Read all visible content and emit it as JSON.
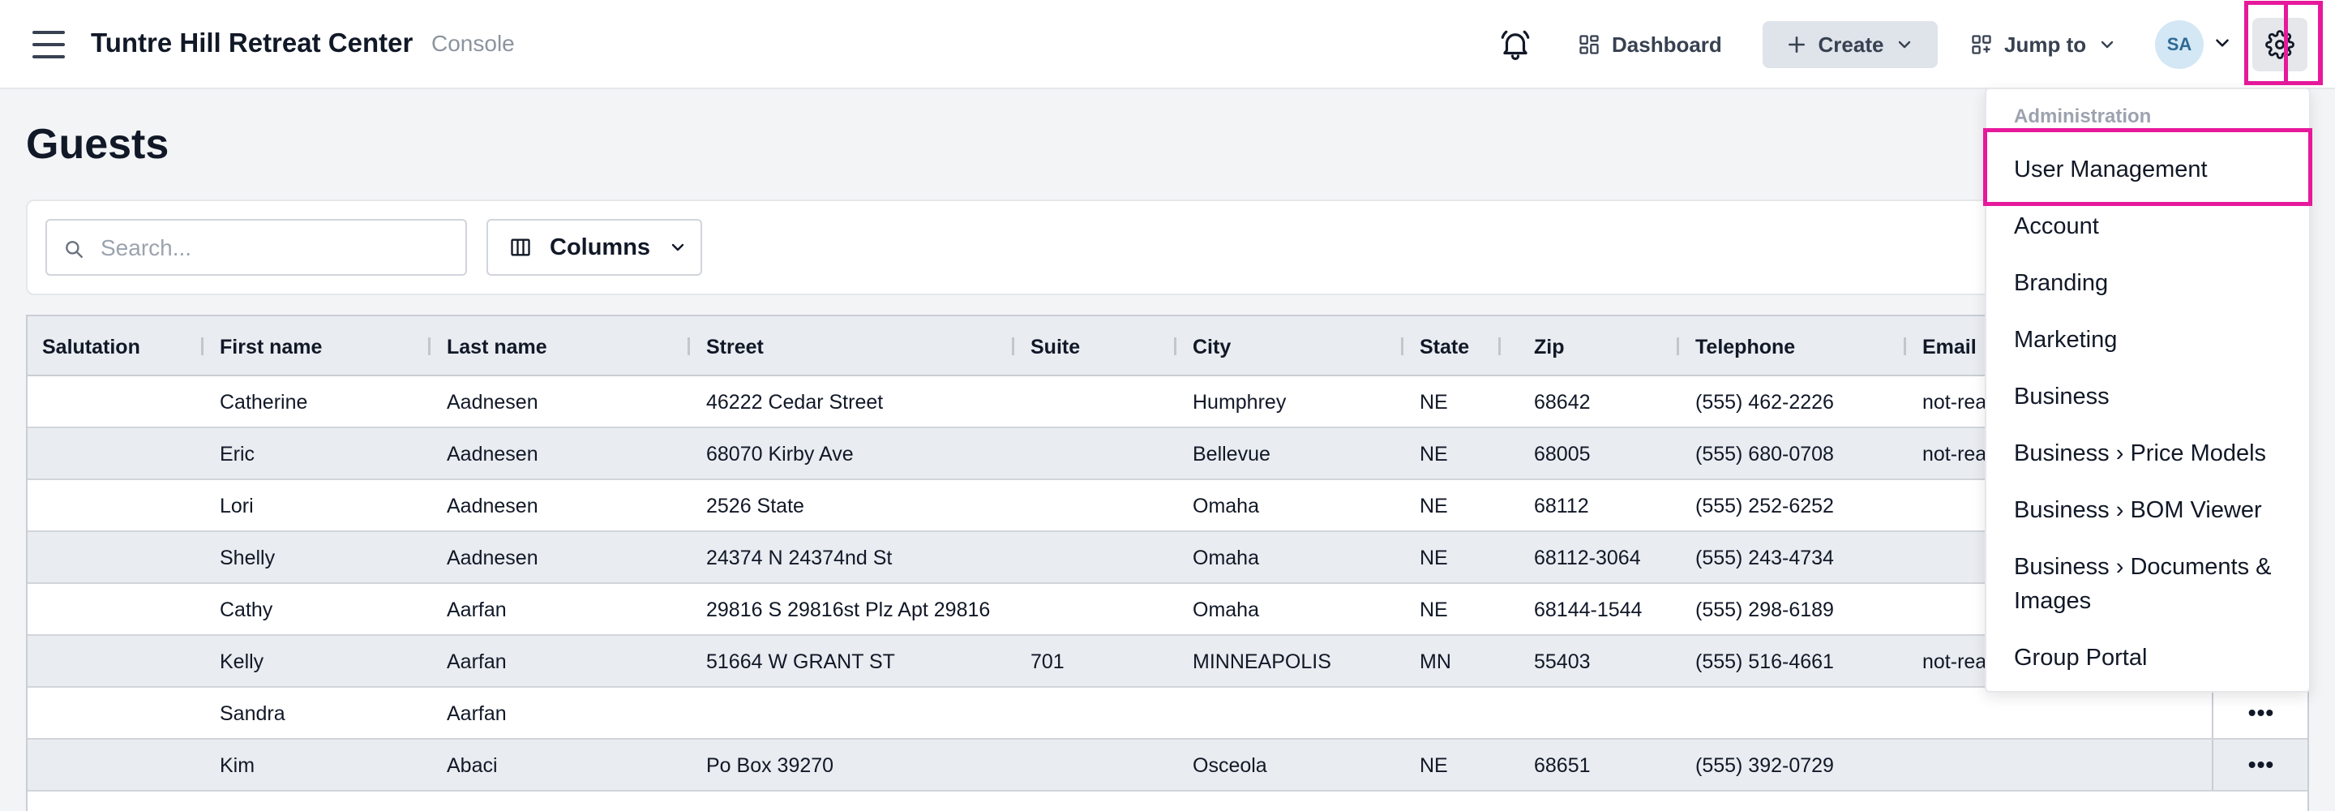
{
  "header": {
    "app_title": "Tuntre Hill Retreat Center",
    "app_subtitle": "Console",
    "dashboard_label": "Dashboard",
    "create_label": "Create",
    "jump_label": "Jump to",
    "avatar_initials": "SA"
  },
  "page": {
    "title": "Guests",
    "search_placeholder": "Search...",
    "columns_label": "Columns"
  },
  "table": {
    "headers": [
      "Salutation",
      "First name",
      "Last name",
      "Street",
      "Suite",
      "City",
      "State",
      "Zip",
      "Telephone",
      "Email"
    ],
    "rows": [
      {
        "first": "Catherine",
        "last": "Aadnesen",
        "street": "46222 Cedar Street",
        "suite": "",
        "city": "Humphrey",
        "state": "NE",
        "zip": "68642",
        "phone": "(555) 462-2226",
        "email": "not-rea"
      },
      {
        "first": "Eric",
        "last": "Aadnesen",
        "street": "68070 Kirby Ave",
        "suite": "",
        "city": "Bellevue",
        "state": "NE",
        "zip": "68005",
        "phone": "(555) 680-0708",
        "email": "not-rea"
      },
      {
        "first": "Lori",
        "last": "Aadnesen",
        "street": "2526 State",
        "suite": "",
        "city": "Omaha",
        "state": "NE",
        "zip": "68112",
        "phone": "(555) 252-6252",
        "email": ""
      },
      {
        "first": "Shelly",
        "last": "Aadnesen",
        "street": "24374 N 24374nd St",
        "suite": "",
        "city": "Omaha",
        "state": "NE",
        "zip": "68112-3064",
        "phone": "(555) 243-4734",
        "email": ""
      },
      {
        "first": "Cathy",
        "last": "Aarfan",
        "street": "29816 S 29816st Plz Apt 29816",
        "suite": "",
        "city": "Omaha",
        "state": "NE",
        "zip": "68144-1544",
        "phone": "(555) 298-6189",
        "email": ""
      },
      {
        "first": "Kelly",
        "last": "Aarfan",
        "street": "51664 W GRANT ST",
        "suite": "701",
        "city": "MINNEAPOLIS",
        "state": "MN",
        "zip": "55403",
        "phone": "(555) 516-4661",
        "email": "not-rea"
      },
      {
        "first": "Sandra",
        "last": "Aarfan",
        "street": "",
        "suite": "",
        "city": "",
        "state": "",
        "zip": "",
        "phone": "",
        "email": ""
      },
      {
        "first": "Kim",
        "last": "Abaci",
        "street": "Po Box 39270",
        "suite": "",
        "city": "Osceola",
        "state": "NE",
        "zip": "68651",
        "phone": "(555) 392-0729",
        "email": ""
      }
    ],
    "actions_label": "•••"
  },
  "menu": {
    "heading": "Administration",
    "items": [
      "User Management",
      "Account",
      "Branding",
      "Marketing",
      "Business",
      "Business › Price Models",
      "Business › BOM Viewer",
      "Business › Documents & Images",
      "Group Portal"
    ]
  },
  "colors": {
    "highlight": "#e6199b",
    "avatar_bg": "#d3e7f5",
    "header_row_bg": "#e9ecf0"
  },
  "icons": [
    "hamburger-icon",
    "bell-icon",
    "dashboard-icon",
    "plus-icon",
    "chevron-down-icon",
    "jump-icon",
    "gear-icon",
    "search-icon",
    "columns-icon"
  ]
}
